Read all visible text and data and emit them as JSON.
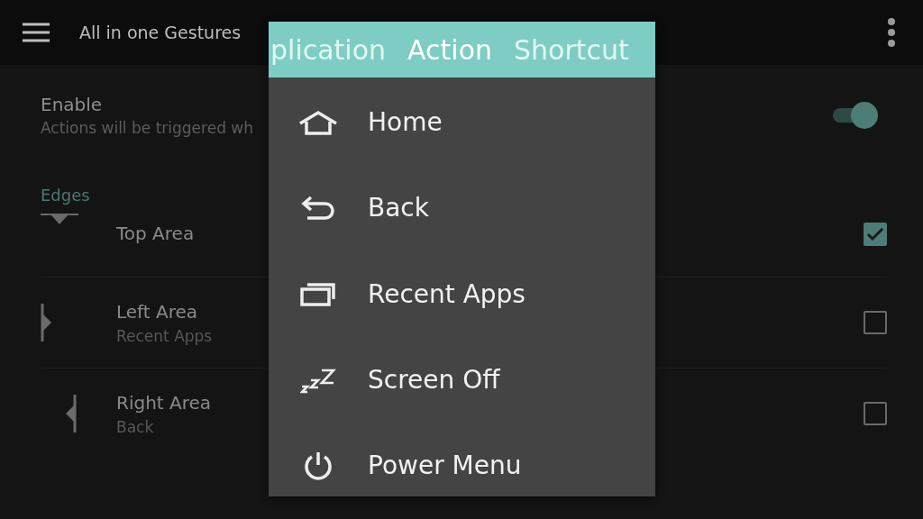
{
  "app_bar": {
    "title": "All in one Gestures"
  },
  "enable": {
    "title": "Enable",
    "subtitle": "Actions will be triggered wh",
    "on": true
  },
  "section": {
    "title": "Edges"
  },
  "edges": [
    {
      "kind": "top",
      "title": "Top Area",
      "checked": true
    },
    {
      "kind": "left",
      "title": "Left Area",
      "subtitle": "Recent Apps",
      "checked": false
    },
    {
      "kind": "right",
      "title": "Right Area",
      "subtitle": "Back",
      "checked": false
    }
  ],
  "popup": {
    "tabs": [
      {
        "label": "plication",
        "selected": false
      },
      {
        "label": "Action",
        "selected": true
      },
      {
        "label": "Shortcut",
        "selected": false
      }
    ],
    "items": [
      {
        "kind": "home",
        "label": "Home"
      },
      {
        "kind": "back",
        "label": "Back"
      },
      {
        "kind": "recent",
        "label": "Recent Apps"
      },
      {
        "kind": "sleep",
        "label": "Screen Off"
      },
      {
        "kind": "power",
        "label": "Power Menu"
      }
    ]
  }
}
